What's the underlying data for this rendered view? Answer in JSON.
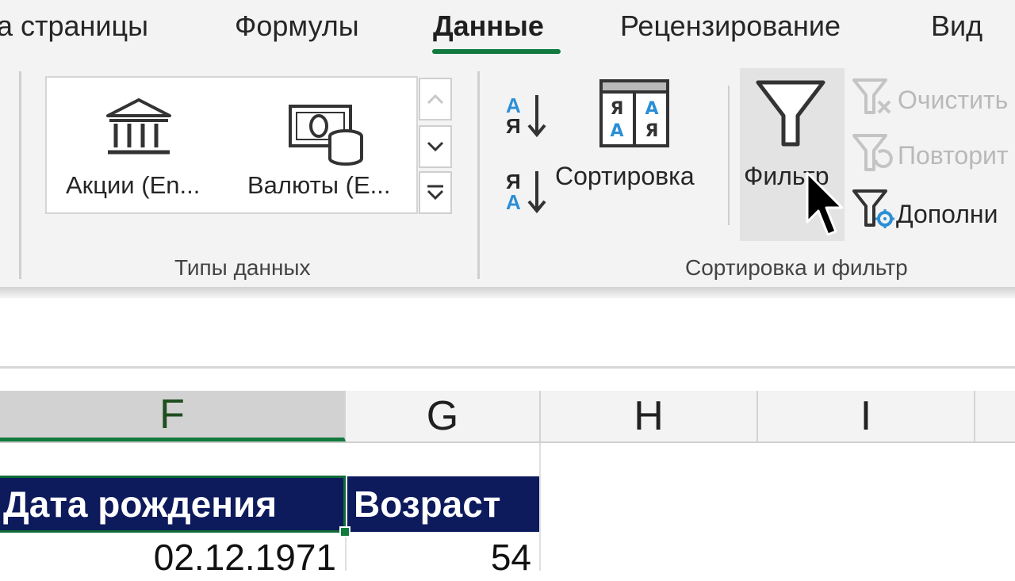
{
  "tabs": [
    {
      "label": "а страницы"
    },
    {
      "label": "Формулы"
    },
    {
      "label": "Данные",
      "active": true
    },
    {
      "label": "Рецензирование"
    },
    {
      "label": "Вид"
    }
  ],
  "ribbon": {
    "data_types": {
      "group_label": "Типы данных",
      "stocks_label": "Акции (En...",
      "currencies_label": "Валюты (E..."
    },
    "sort_filter": {
      "group_label": "Сортировка и фильтр",
      "sort_label": "Сортировка",
      "filter_label": "Фильтр",
      "clear_label": "Очистить",
      "reapply_label": "Повторит",
      "advanced_label": "Дополни",
      "az_top": "А",
      "az_bottom": "Я",
      "za_top": "Я",
      "za_bottom": "А"
    }
  },
  "grid": {
    "columns": [
      "F",
      "G",
      "H",
      "I"
    ],
    "selected_column": "F",
    "header_row": [
      "Дата рождения",
      "Возраст"
    ],
    "data_row": [
      "02.12.1971",
      "54"
    ]
  },
  "colors": {
    "accent_green": "#127a3e",
    "header_fill": "#0d1a5c",
    "sort_blue": "#2b8fd6"
  }
}
